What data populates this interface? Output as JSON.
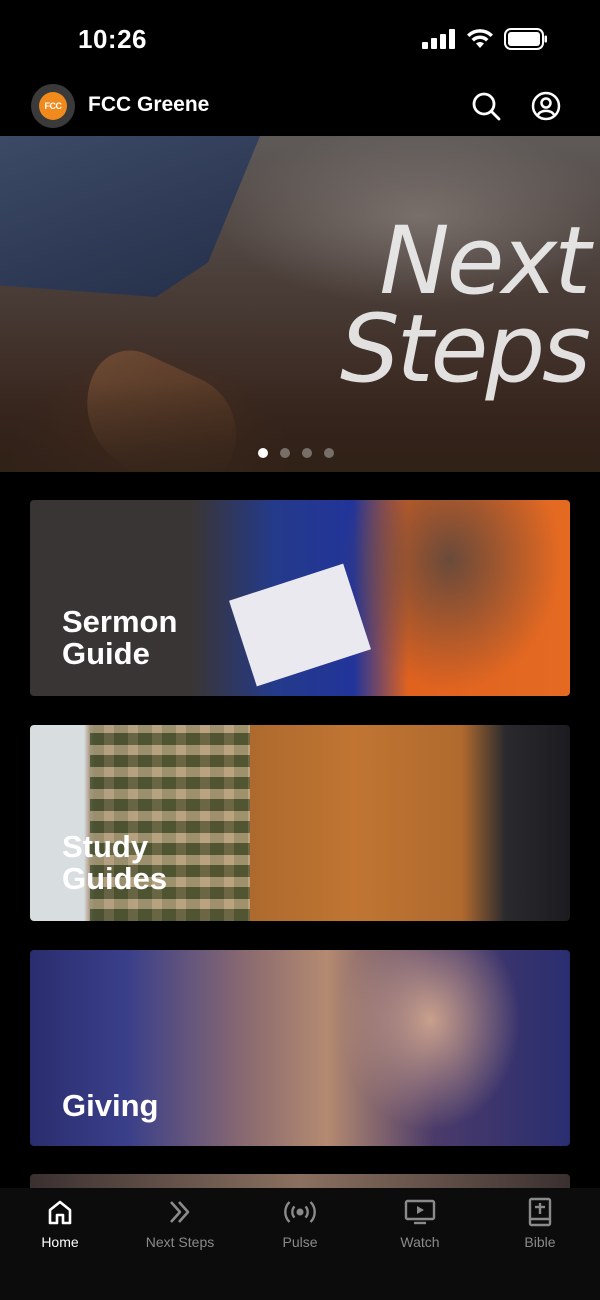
{
  "status": {
    "time": "10:26"
  },
  "header": {
    "logo_text": "FCC",
    "title": "FCC Greene"
  },
  "hero": {
    "line1": "Next",
    "line2": "Steps",
    "slides": 4,
    "active_slide": 1
  },
  "cards": [
    {
      "line1": "Sermon",
      "line2": "Guide"
    },
    {
      "line1": "Study",
      "line2": "Guides"
    },
    {
      "line1": "Giving"
    }
  ],
  "tabs": [
    {
      "label": "Home",
      "icon": "home-icon",
      "active": true
    },
    {
      "label": "Next Steps",
      "icon": "double-chevron-icon",
      "active": false
    },
    {
      "label": "Pulse",
      "icon": "broadcast-icon",
      "active": false
    },
    {
      "label": "Watch",
      "icon": "tv-play-icon",
      "active": false
    },
    {
      "label": "Bible",
      "icon": "book-plus-icon",
      "active": false
    }
  ],
  "colors": {
    "background": "#000000",
    "logo_accent": "#f08a1c",
    "tab_inactive": "#8a8a8a"
  }
}
